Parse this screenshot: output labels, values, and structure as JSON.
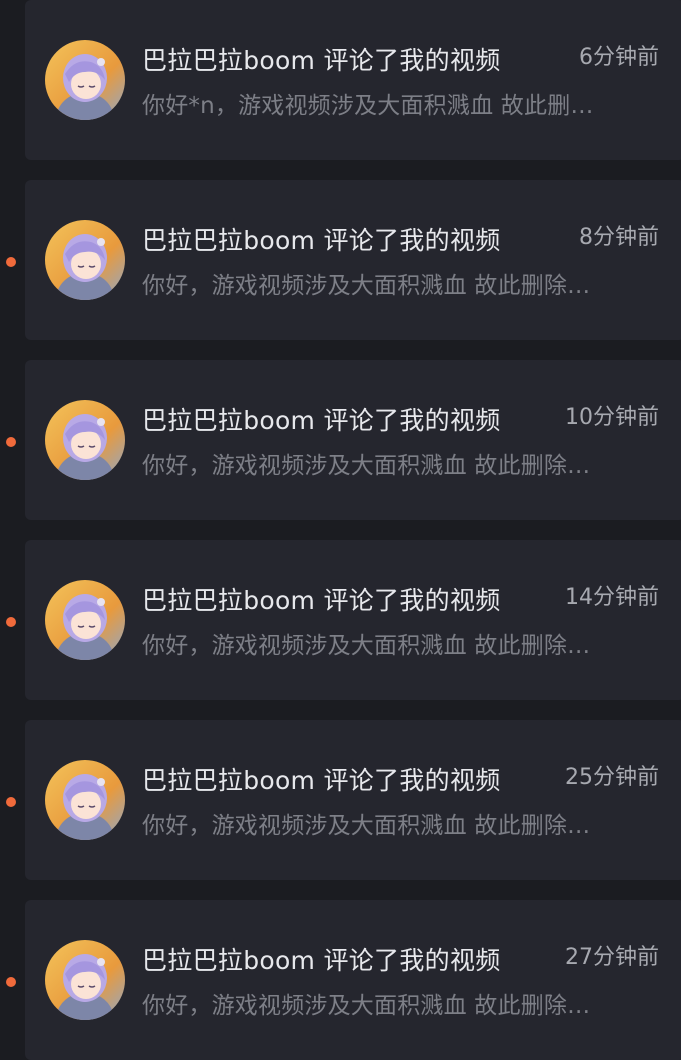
{
  "notifications": [
    {
      "title": "巴拉巴拉boom 评论了我的视频",
      "time": "6分钟前",
      "preview": "你好*n，游戏视频涉及大面积溅血 故此删…",
      "unread": false
    },
    {
      "title": "巴拉巴拉boom 评论了我的视频",
      "time": "8分钟前",
      "preview": "你好，游戏视频涉及大面积溅血 故此删除…",
      "unread": true
    },
    {
      "title": "巴拉巴拉boom 评论了我的视频",
      "time": "10分钟前",
      "preview": "你好，游戏视频涉及大面积溅血 故此删除…",
      "unread": true
    },
    {
      "title": "巴拉巴拉boom 评论了我的视频",
      "time": "14分钟前",
      "preview": "你好，游戏视频涉及大面积溅血 故此删除…",
      "unread": true
    },
    {
      "title": "巴拉巴拉boom 评论了我的视频",
      "time": "25分钟前",
      "preview": "你好，游戏视频涉及大面积溅血 故此删除…",
      "unread": true
    },
    {
      "title": "巴拉巴拉boom 评论了我的视频",
      "time": "27分钟前",
      "preview": "你好，游戏视频涉及大面积溅血 故此删除…",
      "unread": true
    }
  ],
  "colors": {
    "background": "#1b1c21",
    "card": "#25262e",
    "unread_dot": "#f06a3b",
    "title_text": "#e7e8ec",
    "time_text": "#a7a9b0",
    "preview_text": "#7d7f87"
  },
  "avatar_icon": "anime-girl-avatar-icon"
}
